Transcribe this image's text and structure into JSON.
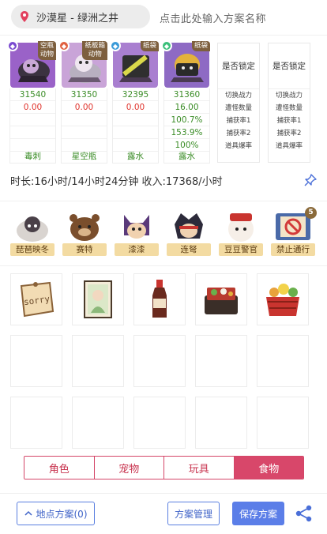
{
  "header": {
    "location": "沙漠星 - 绿洲之井",
    "plan_name_placeholder": "点击此处输入方案名称"
  },
  "cards": [
    {
      "tag": "空瓶\n动物",
      "power": "31540",
      "val": "0.00",
      "extra": [
        "",
        "",
        ""
      ],
      "name": "毒刺"
    },
    {
      "tag": "纸板箱\n动物",
      "power": "31350",
      "val": "0.00",
      "extra": [
        "",
        "",
        ""
      ],
      "name": "星空瓶"
    },
    {
      "tag": "纸袋",
      "power": "32395",
      "val": "0.00",
      "extra": [
        "",
        "",
        ""
      ],
      "name": "露水"
    },
    {
      "tag": "纸袋",
      "power": "31360",
      "val": "16.00",
      "extra": [
        "100.7%",
        "153.9%",
        "100%"
      ],
      "name": "露水"
    }
  ],
  "lock_cards": [
    {
      "head": "是否锁定",
      "rows": [
        "切换战力",
        "遭怪数量",
        "捕获率1",
        "捕获率2",
        "道具爆率"
      ]
    },
    {
      "head": "是否锁定",
      "rows": [
        "切换战力",
        "遭怪数量",
        "捕获率1",
        "捕获率2",
        "道具爆率"
      ]
    }
  ],
  "summary": "时长:16小时/14小时24分钟 收入:17368/小时",
  "pets": [
    {
      "label": "琵琶映冬"
    },
    {
      "label": "赛特"
    },
    {
      "label": "漆漆"
    },
    {
      "label": "连弩"
    },
    {
      "label": "豆豆警官"
    },
    {
      "label": "禁止通行",
      "badge": "5"
    }
  ],
  "items": [
    {
      "icon": "sorry-note-icon",
      "text": "sorry"
    },
    {
      "icon": "portrait-card-icon"
    },
    {
      "icon": "sauce-bottle-icon"
    },
    {
      "icon": "bento-box-icon"
    },
    {
      "icon": "food-basket-icon"
    }
  ],
  "tabs": [
    {
      "label": "角色",
      "active": false
    },
    {
      "label": "宠物",
      "active": false
    },
    {
      "label": "玩具",
      "active": false
    },
    {
      "label": "食物",
      "active": true
    }
  ],
  "bottom": {
    "location_plan": "地点方案(0)",
    "manage": "方案管理",
    "save": "保存方案"
  },
  "colors": {
    "accent": "#d8476a",
    "primary": "#5b7ee8",
    "green": "#3a8c26",
    "red": "#e0352e"
  }
}
